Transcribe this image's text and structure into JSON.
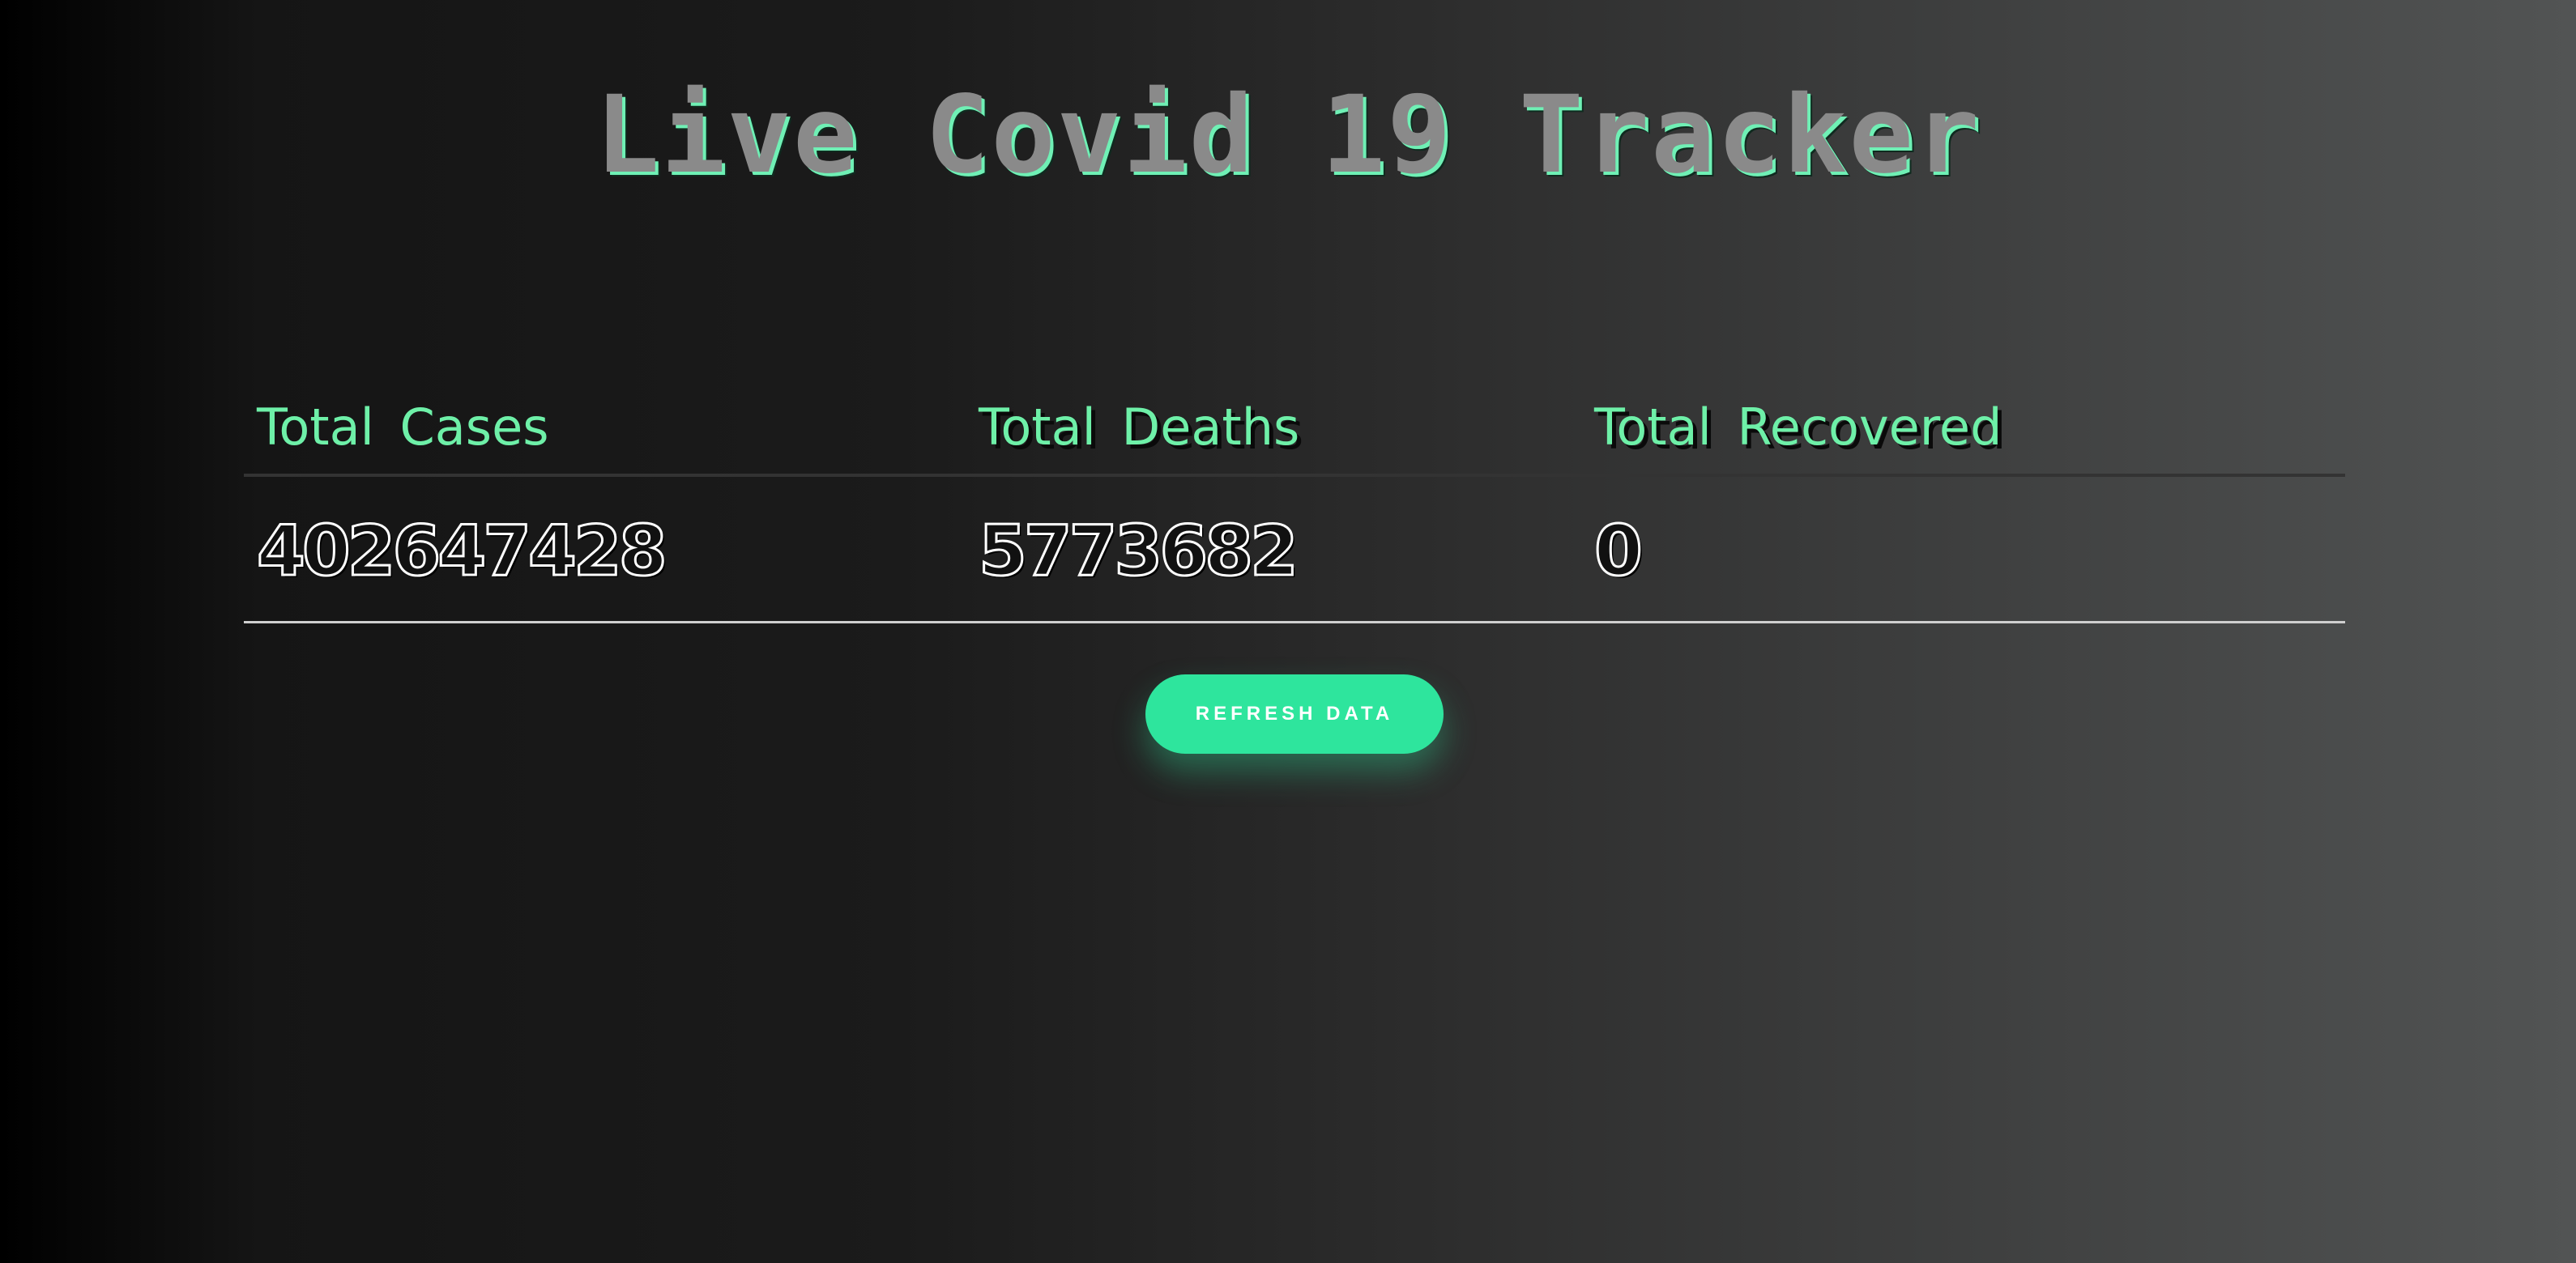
{
  "header": {
    "title": "Live Covid 19 Tracker"
  },
  "stats_table": {
    "columns": [
      "Total Cases",
      "Total Deaths",
      "Total Recovered"
    ],
    "values": [
      "402647428",
      "5773682",
      "0"
    ]
  },
  "actions": {
    "refresh_label": "REFRESH DATA"
  },
  "colors": {
    "accent": "#2ee59d",
    "header_text": "#6ef0a8",
    "title_fill": "#8a8a8a"
  }
}
